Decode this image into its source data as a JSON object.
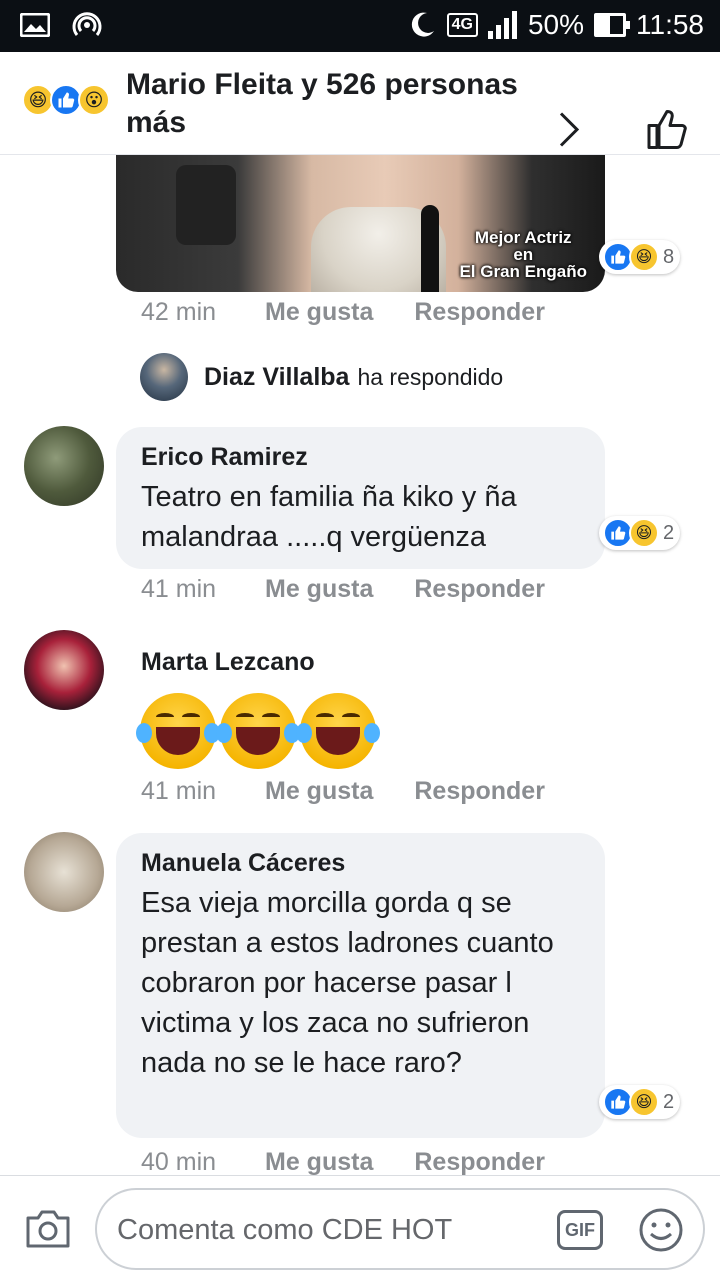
{
  "status_bar": {
    "network": "4G",
    "battery": "50%",
    "time": "11:58"
  },
  "header": {
    "title": "Mario Fleita y 526 personas más"
  },
  "comments": [
    {
      "photo_caption": [
        "Mejor Actriz",
        "en",
        "El Gran Engaño"
      ],
      "reaction_count": "8",
      "time": "42 min",
      "like_label": "Me gusta",
      "reply_label": "Responder"
    },
    {
      "author": "Erico Ramirez",
      "text": "Teatro en familia ña kiko y ña malandraa .....q vergüenza",
      "reaction_count": "2",
      "time": "41 min",
      "like_label": "Me gusta",
      "reply_label": "Responder"
    },
    {
      "author": "Marta Lezcano",
      "text": "😂😂😂",
      "time": "41 min",
      "like_label": "Me gusta",
      "reply_label": "Responder"
    },
    {
      "author": "Manuela Cáceres",
      "text": "Esa vieja morcilla gorda q se prestan a estos ladrones cuanto cobraron por hacerse pasar l victima y los zaca no sufrieron nada no se le hace raro?",
      "reaction_count": "2",
      "time": "40 min",
      "like_label": "Me gusta",
      "reply_label": "Responder"
    }
  ],
  "reply_notice": {
    "name": "Diaz Villalba",
    "text": "ha respondido"
  },
  "composer": {
    "placeholder": "Comenta como CDE HOT",
    "gif_label": "GIF"
  }
}
